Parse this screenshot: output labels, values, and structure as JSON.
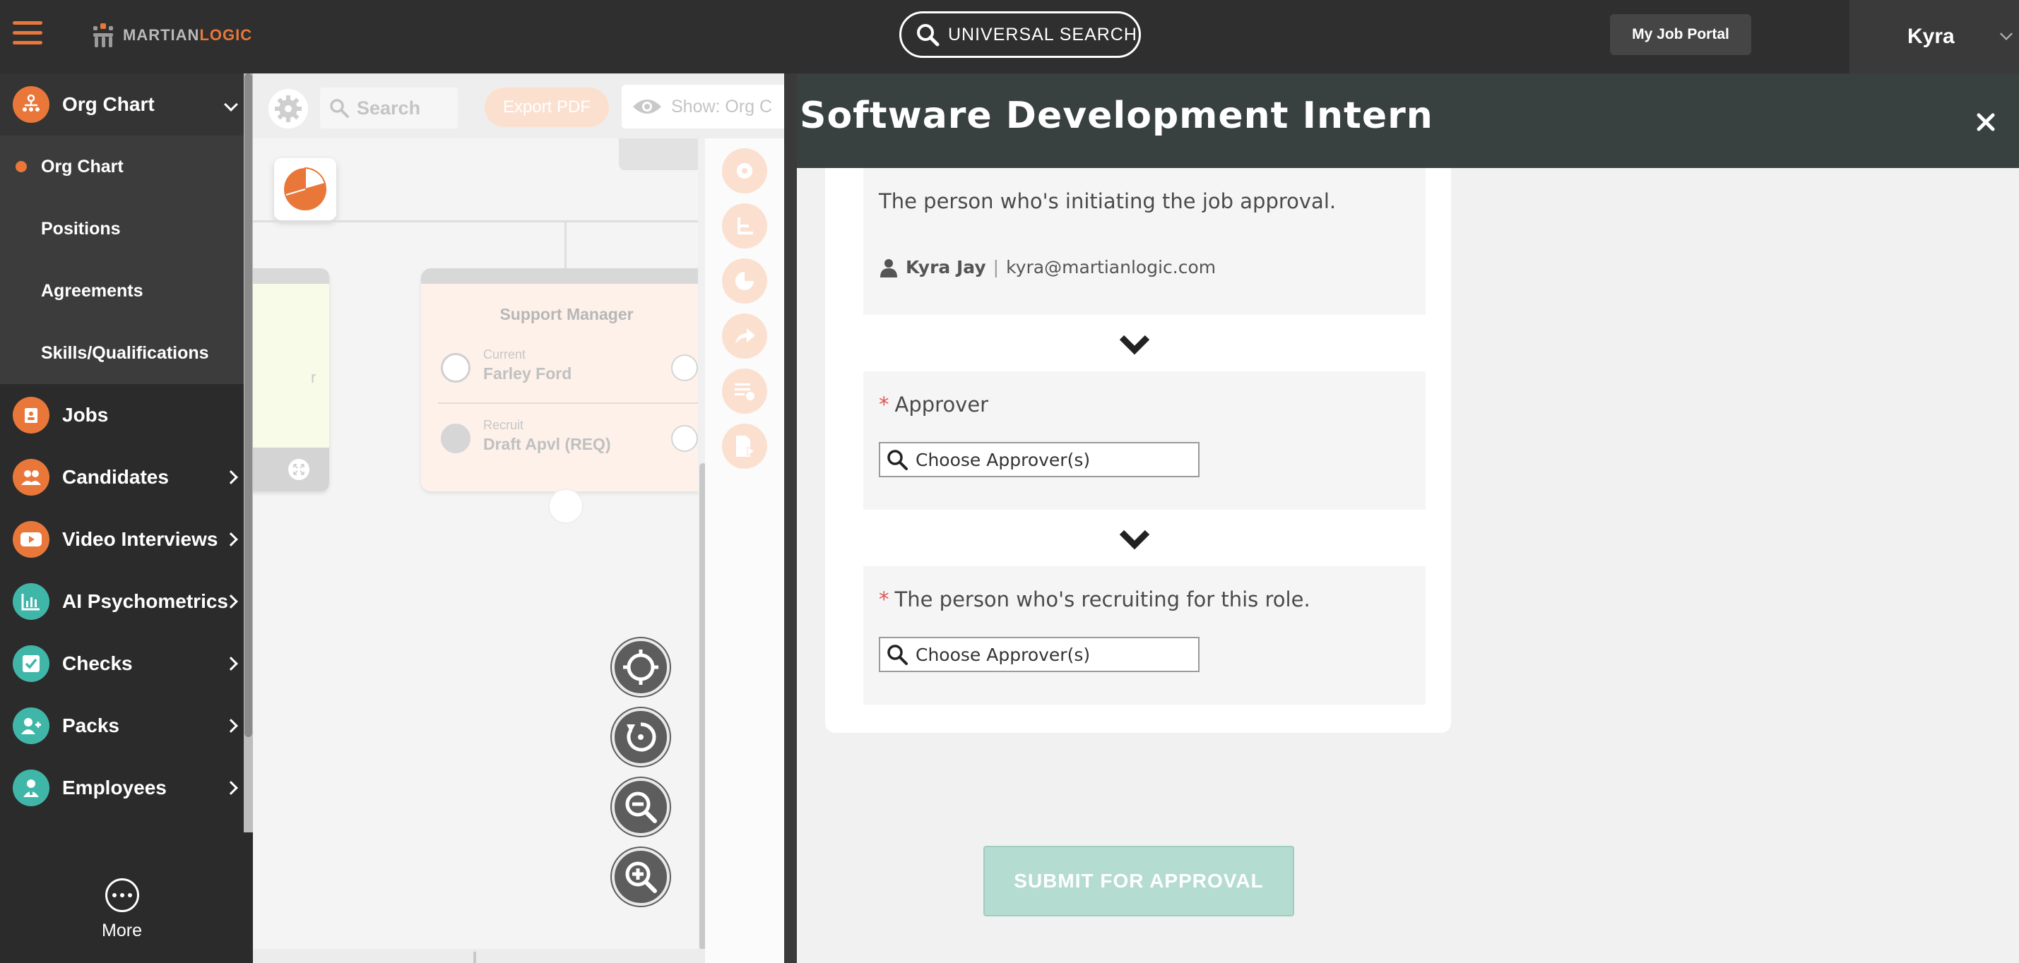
{
  "header": {
    "logo_text_primary": "MARTIAN",
    "logo_text_accent": "LOGIC",
    "universal_search_label": "UNIVERSAL SEARCH",
    "job_portal_label": "My Job Portal",
    "user_name": "Kyra"
  },
  "sidebar": {
    "items": [
      {
        "label": "Org Chart",
        "icon": "org-chart-icon",
        "color": "#e9773a",
        "arrow": "down"
      },
      {
        "label": "Jobs",
        "icon": "jobs-icon",
        "color": "#e9773a"
      },
      {
        "label": "Candidates",
        "icon": "candidates-icon",
        "color": "#e9773a",
        "arrow": "right"
      },
      {
        "label": "Video Interviews",
        "icon": "video-icon",
        "color": "#e9773a",
        "arrow": "right"
      },
      {
        "label": "AI Psychometrics",
        "icon": "psychometrics-icon",
        "color": "#3fb6a8",
        "arrow": "right"
      },
      {
        "label": "Checks",
        "icon": "checks-icon",
        "color": "#3fb6a8",
        "arrow": "right"
      },
      {
        "label": "Packs",
        "icon": "packs-icon",
        "color": "#3fb6a8",
        "arrow": "right"
      },
      {
        "label": "Employees",
        "icon": "employees-icon",
        "color": "#3fb6a8",
        "arrow": "right"
      }
    ],
    "sub_items": [
      {
        "label": "Org Chart",
        "active": true
      },
      {
        "label": "Positions"
      },
      {
        "label": "Agreements"
      },
      {
        "label": "Skills/Qualifications"
      }
    ],
    "more_label": "More"
  },
  "canvas": {
    "search_placeholder": "Search",
    "export_label": "Export PDF",
    "show_label": "Show: Org C",
    "left_card_fragment": "r",
    "card": {
      "title": "Support Manager",
      "rows": [
        {
          "kind": "Current",
          "name": "Farley Ford"
        },
        {
          "kind": "Recruit",
          "name": "Draft Apvl (REQ)"
        }
      ]
    }
  },
  "panel": {
    "title": "Software Development Intern",
    "initiator_question": "The person who's initiating the job approval.",
    "initiator_name": "Kyra Jay",
    "initiator_separator": "|",
    "initiator_email": "kyra@martianlogic.com",
    "approver_label": "Approver",
    "approver_required": "*",
    "approver_placeholder": "Choose Approver(s)",
    "recruiter_label": "The person who's recruiting for this role.",
    "recruiter_required": "*",
    "recruiter_placeholder": "Choose Approver(s)",
    "submit_label": "SUBMIT FOR APPROVAL"
  },
  "colors": {
    "accent": "#e9773a",
    "teal": "#3fb6a8",
    "header_bg": "#2f2f2f",
    "panel_header_bg": "#384040",
    "submit_bg": "#b5dcd1"
  }
}
